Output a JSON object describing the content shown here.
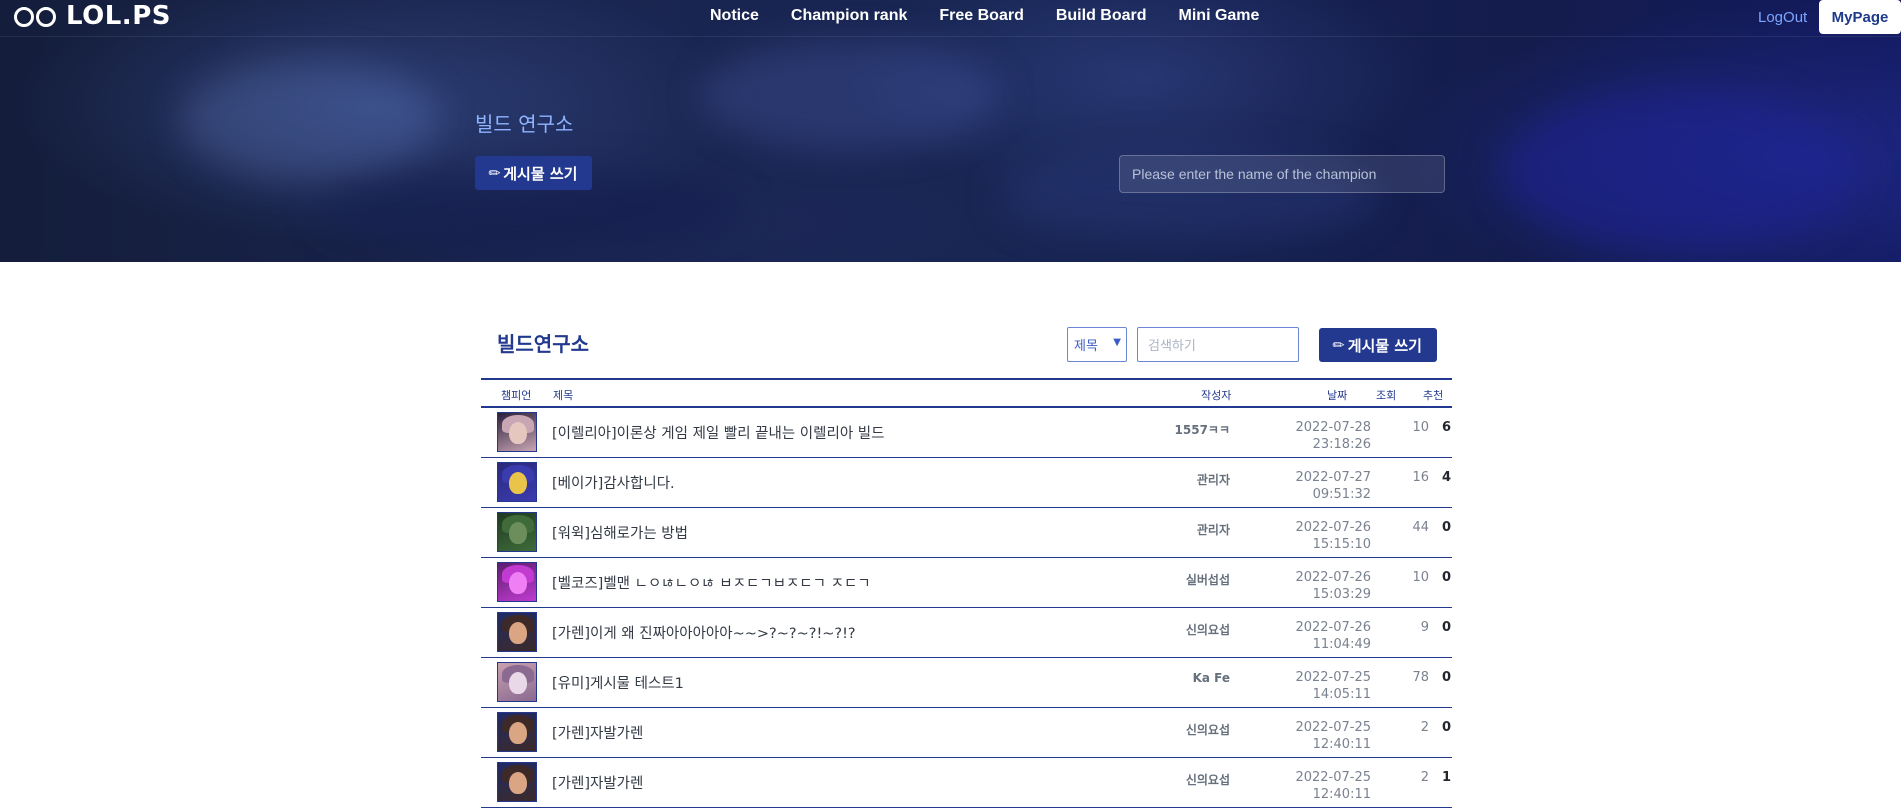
{
  "nav": {
    "logo": "LOL.PS",
    "items": [
      "Notice",
      "Champion rank",
      "Free Board",
      "Build Board",
      "Mini Game"
    ],
    "logout": "LogOut",
    "mypage": "MyPage"
  },
  "hero": {
    "title": "빌드 연구소",
    "write_button": "게시물 쓰기",
    "search_placeholder": "Please enter the name of the champion"
  },
  "board": {
    "title": "빌드연구소",
    "filter_selected": "제목",
    "search_placeholder": "검색하기",
    "write_button": "게시물 쓰기",
    "columns": [
      "챔피언",
      "제목",
      "작성자",
      "날짜",
      "조회",
      "추천"
    ],
    "rows": [
      {
        "title": "[이렐리아]이론상 게임 제일 빨리 끝내는 이렐리아 빌드",
        "author": "1557ㅋㅋ",
        "date": "2022-07-28",
        "time": "23:18:26",
        "views": "10",
        "recs": "6",
        "avatar_colors": [
          "#2a1f3a",
          "#c9a6b4",
          "#e6c7c0"
        ]
      },
      {
        "title": "[베이가]감사합니다.",
        "author": "관리자",
        "date": "2022-07-27",
        "time": "09:51:32",
        "views": "16",
        "recs": "4",
        "avatar_colors": [
          "#2a2a7a",
          "#3b3bb0",
          "#e9c34a"
        ]
      },
      {
        "title": "[워윅]심해로가는 방법",
        "author": "관리자",
        "date": "2022-07-26",
        "time": "15:15:10",
        "views": "44",
        "recs": "0",
        "avatar_colors": [
          "#1f3a22",
          "#3f6b3a",
          "#6b8e5c"
        ]
      },
      {
        "title": "[벨코즈]벨맨 ㄴㅇㄶㄴㅇㄶ ㅂㅈㄷㄱㅂㅈㄷㄱ ㅈㄷㄱ",
        "author": "실버섭섭",
        "date": "2022-07-26",
        "time": "15:03:29",
        "views": "10",
        "recs": "0",
        "avatar_colors": [
          "#5a1f6e",
          "#c13bd1",
          "#f07ef5"
        ]
      },
      {
        "title": "[가렌]이게 왜 진짜아아아아아~~>?~?~?!~?!?",
        "author": "신의요섭",
        "date": "2022-07-26",
        "time": "11:04:49",
        "views": "9",
        "recs": "0",
        "avatar_colors": [
          "#1f2a66",
          "#3d2a28",
          "#d9a583"
        ]
      },
      {
        "title": "[유미]게시물 테스트1",
        "author": "Ka Fe",
        "date": "2022-07-25",
        "time": "14:05:11",
        "views": "78",
        "recs": "0",
        "avatar_colors": [
          "#c9a0b0",
          "#8a6a90",
          "#e8d8e8"
        ]
      },
      {
        "title": "[가렌]자발가렌",
        "author": "신의요섭",
        "date": "2022-07-25",
        "time": "12:40:11",
        "views": "2",
        "recs": "0",
        "avatar_colors": [
          "#1f2a66",
          "#3d2a28",
          "#d9a583"
        ]
      },
      {
        "title": "[가렌]자발가렌",
        "author": "신의요섭",
        "date": "2022-07-25",
        "time": "12:40:11",
        "views": "2",
        "recs": "1",
        "avatar_colors": [
          "#1f2a66",
          "#3d2a28",
          "#d9a583"
        ]
      }
    ]
  },
  "colors": {
    "brand": "#23398f",
    "link": "#7ea6ff"
  }
}
